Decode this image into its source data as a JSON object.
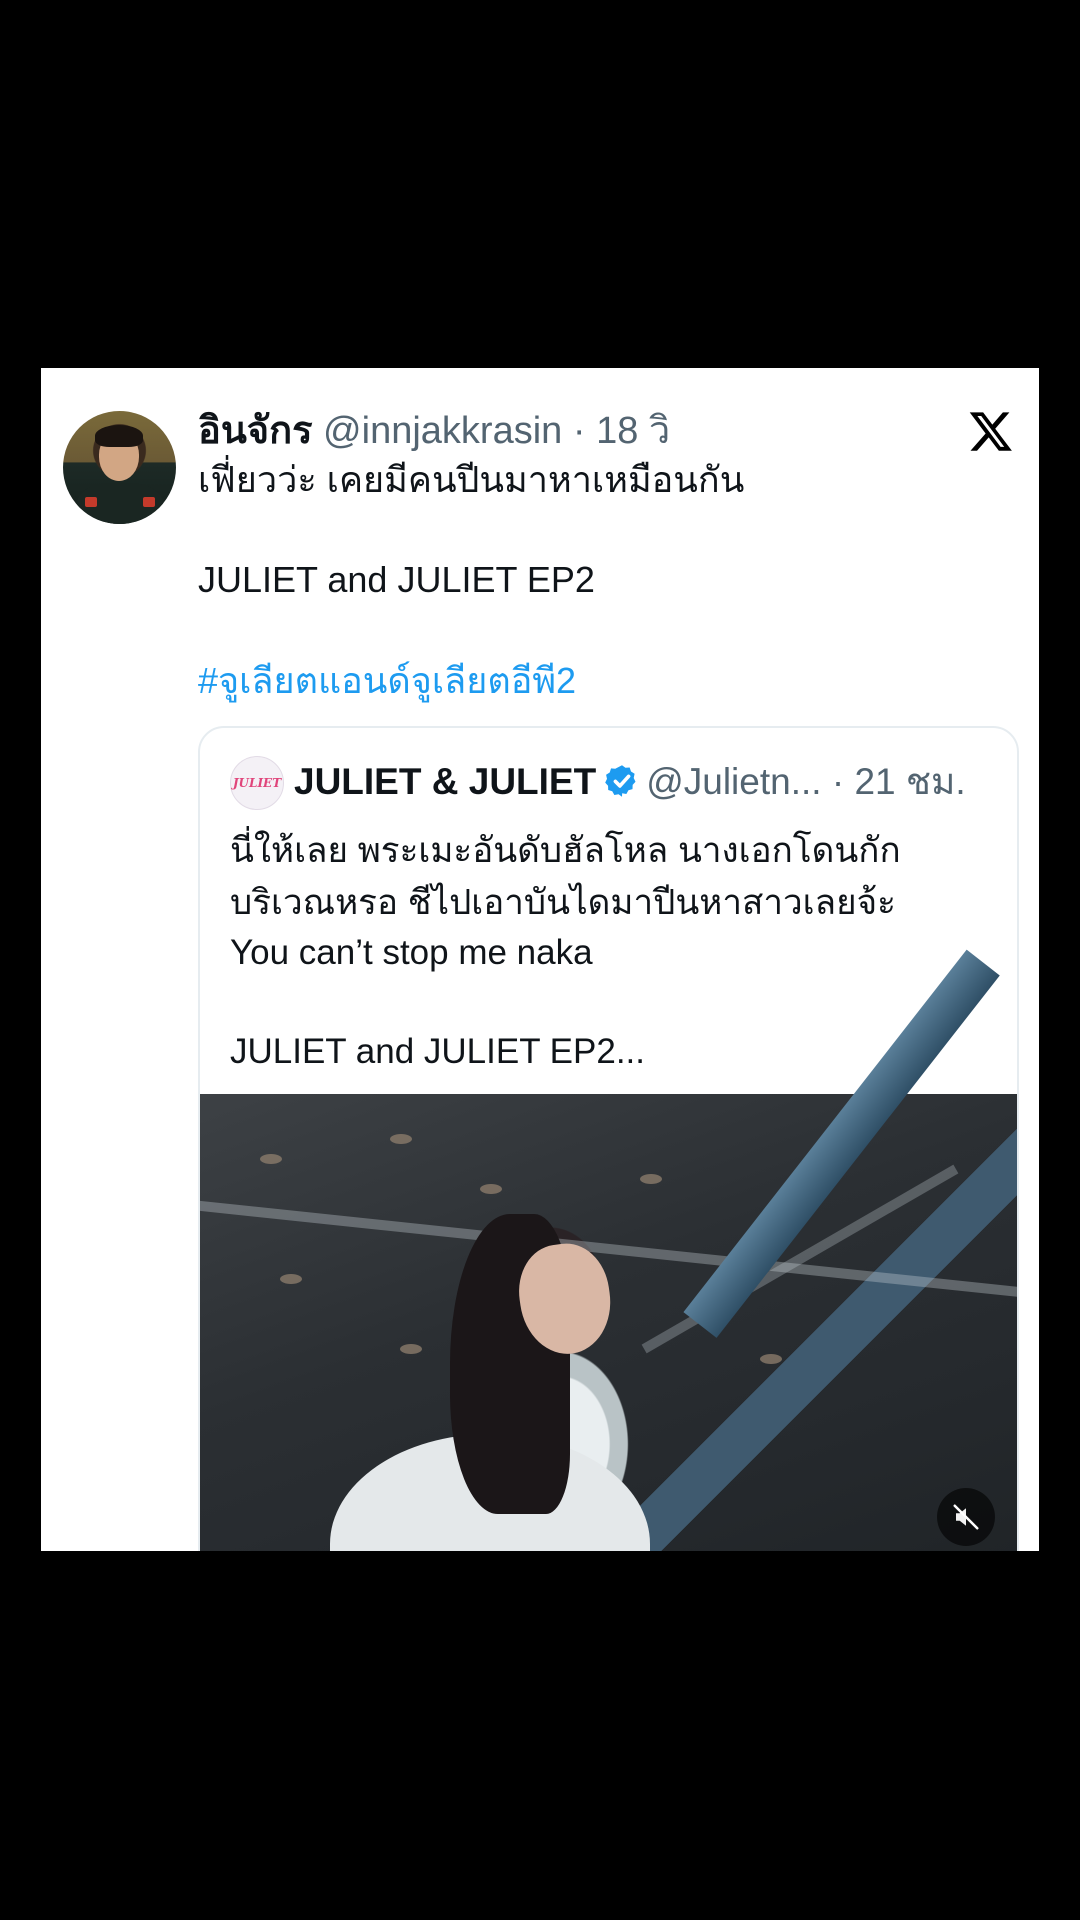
{
  "tweet": {
    "display_name": "อินจักร",
    "handle": "@innjakkrasin",
    "separator": "·",
    "time": "18 วิ",
    "line1": "เฟี่ยวว่ะ เคยมีคนปีนมาหาเหมือนกัน",
    "line2": "JULIET and JULIET EP2",
    "hashtag": "#จูเลียตแอนด์จูเลียตอีพี2"
  },
  "quoted": {
    "avatar_text": "JULIET",
    "display_name": "JULIET & JULIET",
    "handle": "@Julietn...",
    "separator": "·",
    "time": "21 ชม.",
    "line1": "นี่ให้เลย พระเมะอันดับฮัลโหล นางเอกโดนกัก",
    "line2": "บริเวณหรอ ชีไปเอาบันไดมาปีนหาสาวเลยจ้ะ",
    "line3": "You can’t stop me naka",
    "line4": "JULIET and JULIET EP2..."
  },
  "icons": {
    "logo": "x-logo-icon",
    "verified": "verified-badge-icon",
    "mute": "mute-icon"
  },
  "colors": {
    "background": "#000000",
    "card": "#ffffff",
    "text": "#0f1419",
    "secondary": "#536471",
    "link": "#1d9bf0",
    "verified": "#1d9bf0"
  }
}
